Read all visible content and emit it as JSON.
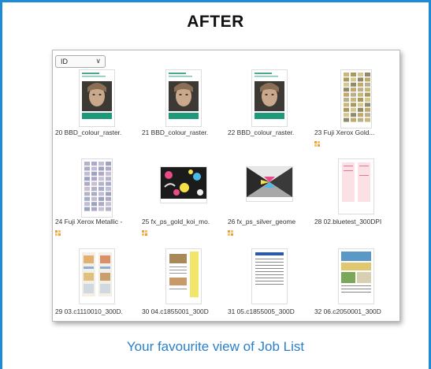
{
  "header": {
    "title": "AFTER"
  },
  "sort_select": {
    "value": "ID"
  },
  "items": [
    {
      "caption": "20  BBD_colour_raster.",
      "kind": "portrait"
    },
    {
      "caption": "21  BBD_colour_raster.",
      "kind": "portrait"
    },
    {
      "caption": "22  BBD_colour_raster.",
      "kind": "portrait"
    },
    {
      "caption": "23  Fuji Xerox Gold...",
      "kind": "swatch-gold",
      "badge": true
    },
    {
      "caption": "24  Fuji Xerox Metallic -",
      "kind": "swatch-metal",
      "badge": true
    },
    {
      "caption": "25  fx_ps_gold_koi_mo.",
      "kind": "koi",
      "badge": true
    },
    {
      "caption": "26  fx_ps_silver_geome",
      "kind": "geometric",
      "badge": true
    },
    {
      "caption": "28  02.bluetest_300DPI",
      "kind": "doc-pink"
    },
    {
      "caption": "29  03.c1110010_300D.",
      "kind": "doc-columns"
    },
    {
      "caption": "30  04.c1855001_300D",
      "kind": "doc-yellow"
    },
    {
      "caption": "31  05.c1855005_300D",
      "kind": "doc-text"
    },
    {
      "caption": "32  06.c2050001_300D",
      "kind": "doc-blue"
    }
  ],
  "footer": {
    "text": "Your favourite view of Job List"
  },
  "colors": {
    "accent": "#1f8ad6",
    "footer_text": "#2a7fc9",
    "badge": "#f0a030"
  }
}
